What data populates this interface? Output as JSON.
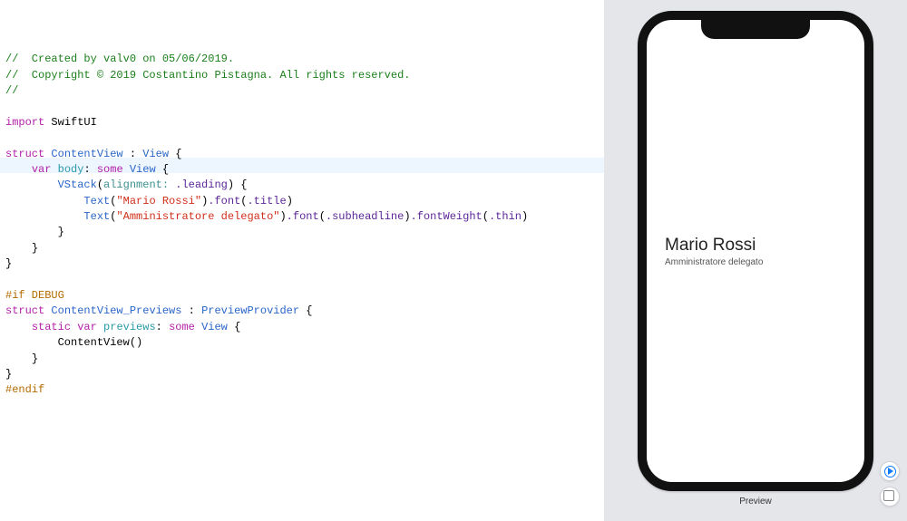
{
  "code": {
    "c1": "//  Created by valv0 on 05/06/2019.",
    "c2": "//  Copyright © 2019 Costantino Pistagna. All rights reserved.",
    "c3": "//",
    "import": "import",
    "swiftui": "SwiftUI",
    "struct": "struct",
    "contentview": "ContentView",
    "view": "View",
    "var": "var",
    "body": "body",
    "some": "some",
    "vstack": "VStack",
    "alignment": "alignment:",
    "leading": ".leading",
    "text": "Text",
    "str1": "\"Mario Rossi\"",
    "str2": "\"Amministratore delegato\"",
    "font": ".font",
    "title": ".title",
    "subheadline": ".subheadline",
    "fontweight": ".fontWeight",
    "thin": ".thin",
    "ifdebug": "#if DEBUG",
    "previews_struct": "ContentView_Previews",
    "previewprovider": "PreviewProvider",
    "static": "static",
    "previews": "previews",
    "cv_call": "ContentView()",
    "endif": "#endif"
  },
  "preview": {
    "title": "Mario Rossi",
    "subtitle": "Amministratore delegato",
    "label": "Preview"
  }
}
